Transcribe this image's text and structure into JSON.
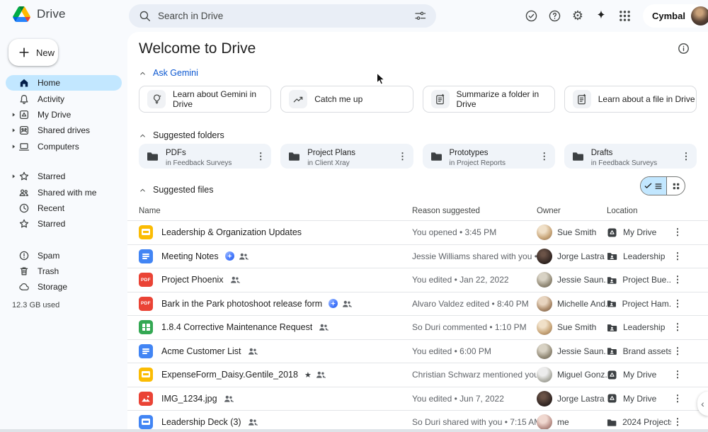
{
  "topbar": {
    "app_name": "Drive",
    "search_placeholder": "Search in Drive",
    "account_name": "Cymbal",
    "action_icons": [
      "search-options",
      "offline-status",
      "help",
      "settings",
      "gemini",
      "apps-grid"
    ]
  },
  "sidebar": {
    "new_label": "New",
    "groups": [
      {
        "items": [
          {
            "label": "Home",
            "icon": "home",
            "selected": true
          },
          {
            "label": "Activity",
            "icon": "bell"
          },
          {
            "label": "My Drive",
            "icon": "mydrive",
            "chevron": true
          },
          {
            "label": "Shared drives",
            "icon": "shared-drive",
            "chevron": true
          },
          {
            "label": "Computers",
            "icon": "laptop",
            "chevron": true
          }
        ]
      },
      {
        "items": [
          {
            "label": "Starred",
            "icon": "star",
            "chevron": true
          },
          {
            "label": "Shared with me",
            "icon": "people"
          },
          {
            "label": "Recent",
            "icon": "clock"
          },
          {
            "label": "Starred",
            "icon": "star"
          }
        ]
      },
      {
        "items": [
          {
            "label": "Spam",
            "icon": "alert"
          },
          {
            "label": "Trash",
            "icon": "trash"
          },
          {
            "label": "Storage",
            "icon": "cloud"
          }
        ]
      }
    ],
    "storage_used": "12.3 GB used"
  },
  "labels": {
    "pdf_badge": "PDF"
  },
  "colors": {
    "accent_blue": "#0b57d0",
    "selected_pill": "#c2e7ff",
    "surface": "#f8fafd",
    "docs": "#4285f4",
    "sheets": "#34a853",
    "slides": "#fbbc04",
    "pdf": "#ea4335"
  },
  "main": {
    "title": "Welcome to Drive",
    "ask_gemini": {
      "label": "Ask Gemini",
      "buttons": [
        {
          "label": "Learn about Gemini in Drive",
          "icon": "lightbulb"
        },
        {
          "label": "Catch me up",
          "icon": "trending"
        },
        {
          "label": "Summarize a folder in Drive",
          "icon": "doc"
        },
        {
          "label": "Learn about a file in Drive",
          "icon": "doc"
        }
      ]
    },
    "suggested_folders": {
      "label": "Suggested folders",
      "folders": [
        {
          "name": "PDFs",
          "location": "in Feedback Surveys"
        },
        {
          "name": "Project Plans",
          "location": "in Client Xray"
        },
        {
          "name": "Prototypes",
          "location": "in Project Reports"
        },
        {
          "name": "Drafts",
          "location": "in Feedback Surveys"
        }
      ]
    },
    "suggested_files": {
      "label": "Suggested files",
      "columns": {
        "name": "Name",
        "reason": "Reason suggested",
        "owner": "Owner",
        "location": "Location"
      },
      "rows": [
        {
          "icon": "slides",
          "name": "Leadership & Organization Updates",
          "reason": "You opened • 3:45 PM",
          "owner": "Sue Smith",
          "avatar": "sue",
          "location": "My Drive",
          "loc_icon": "mydrive"
        },
        {
          "icon": "docs",
          "name": "Meeting Notes",
          "gemini": true,
          "people": true,
          "reason": "Jessie Williams shared with you • ...",
          "owner": "Jorge Lastra",
          "avatar": "jorge",
          "location": "Leadership",
          "loc_icon": "shared-folder"
        },
        {
          "icon": "pdf",
          "name": "Project Phoenix",
          "people": true,
          "reason": "You edited • Jan 22, 2022",
          "owner": "Jessie Saun...",
          "avatar": "jessie",
          "location": "Project Bue...",
          "loc_icon": "shared-folder"
        },
        {
          "icon": "pdf",
          "name": "Bark in the Park photoshoot release form",
          "gemini": true,
          "people": true,
          "reason": "Alvaro Valdez edited • 8:40 PM",
          "owner": "Michelle And...",
          "avatar": "michelle",
          "location": "Project Ham...",
          "loc_icon": "shared-folder"
        },
        {
          "icon": "sheets",
          "name": "1.8.4 Corrective Maintenance Request",
          "people": true,
          "reason": "So Duri commented • 1:10 PM",
          "owner": "Sue Smith",
          "avatar": "sue",
          "location": "Leadership",
          "loc_icon": "shared-folder"
        },
        {
          "icon": "docs",
          "name": "Acme Customer List",
          "people": true,
          "reason": "You edited • 6:00 PM",
          "owner": "Jessie Saun...",
          "avatar": "jessie",
          "location": "Brand assets",
          "loc_icon": "shared-folder"
        },
        {
          "icon": "slides",
          "name": "ExpenseForm_Daisy.Gentile_2018",
          "star": true,
          "people": true,
          "reason": "Christian Schwarz mentioned you • ...",
          "owner": "Miguel Gonz...",
          "avatar": "miguel",
          "location": "My Drive",
          "loc_icon": "mydrive"
        },
        {
          "icon": "image",
          "name": "IMG_1234.jpg",
          "people": true,
          "reason": "You edited • Jun 7, 2022",
          "owner": "Jorge Lastra",
          "avatar": "jorge",
          "location": "My Drive",
          "loc_icon": "mydrive"
        },
        {
          "icon": "deck",
          "name": "Leadership Deck (3)",
          "people": true,
          "reason": "So Duri shared with you • 7:15 AM",
          "owner": "me",
          "avatar": "me",
          "location": "2024 Projects",
          "loc_icon": "folder"
        }
      ]
    }
  }
}
